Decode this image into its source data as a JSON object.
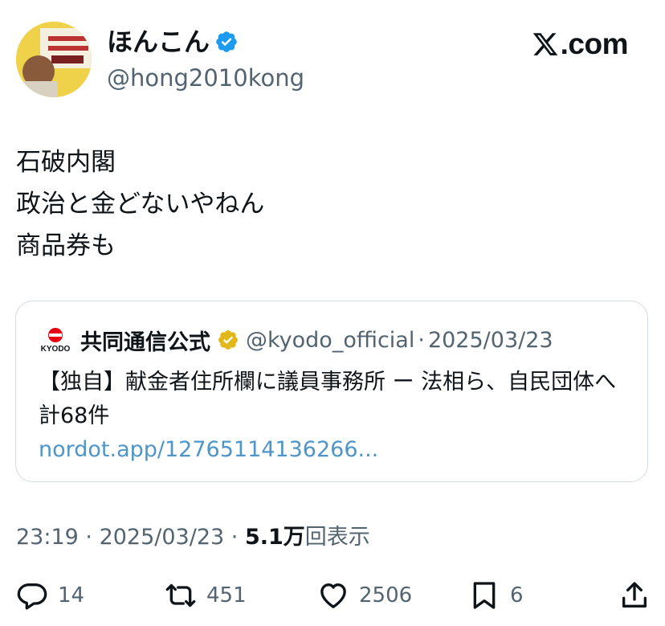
{
  "author": {
    "display_name": "ほんこん",
    "handle": "@hong2010kong",
    "verified_color": "#1d9bf0"
  },
  "brand": {
    "label": ".com"
  },
  "tweet": {
    "lines": [
      "石破内閣",
      "政治と金どないやねん",
      "商品券も"
    ]
  },
  "quote": {
    "logo_text": "KYODO",
    "name": "共同通信公式",
    "handle": "@kyodo_official",
    "separator": "·",
    "date": "2025/03/23",
    "body": "【独自】献金者住所欄に議員事務所 ー 法相ら、自民団体へ計68件",
    "link": "nordot.app/12765114136266..."
  },
  "meta": {
    "time": "23:19",
    "sep1": " · ",
    "date": "2025/03/23",
    "sep2": " · ",
    "views_count": "5.1万",
    "views_label": "回表示"
  },
  "actions": {
    "replies": "14",
    "reposts": "451",
    "likes": "2506",
    "bookmarks": "6"
  },
  "icons": {
    "verified": "verified-badge-icon",
    "gold_verified": "gold-verified-badge-icon",
    "reply": "reply-icon",
    "repost": "repost-icon",
    "like": "heart-icon",
    "bookmark": "bookmark-icon",
    "share": "share-icon"
  }
}
